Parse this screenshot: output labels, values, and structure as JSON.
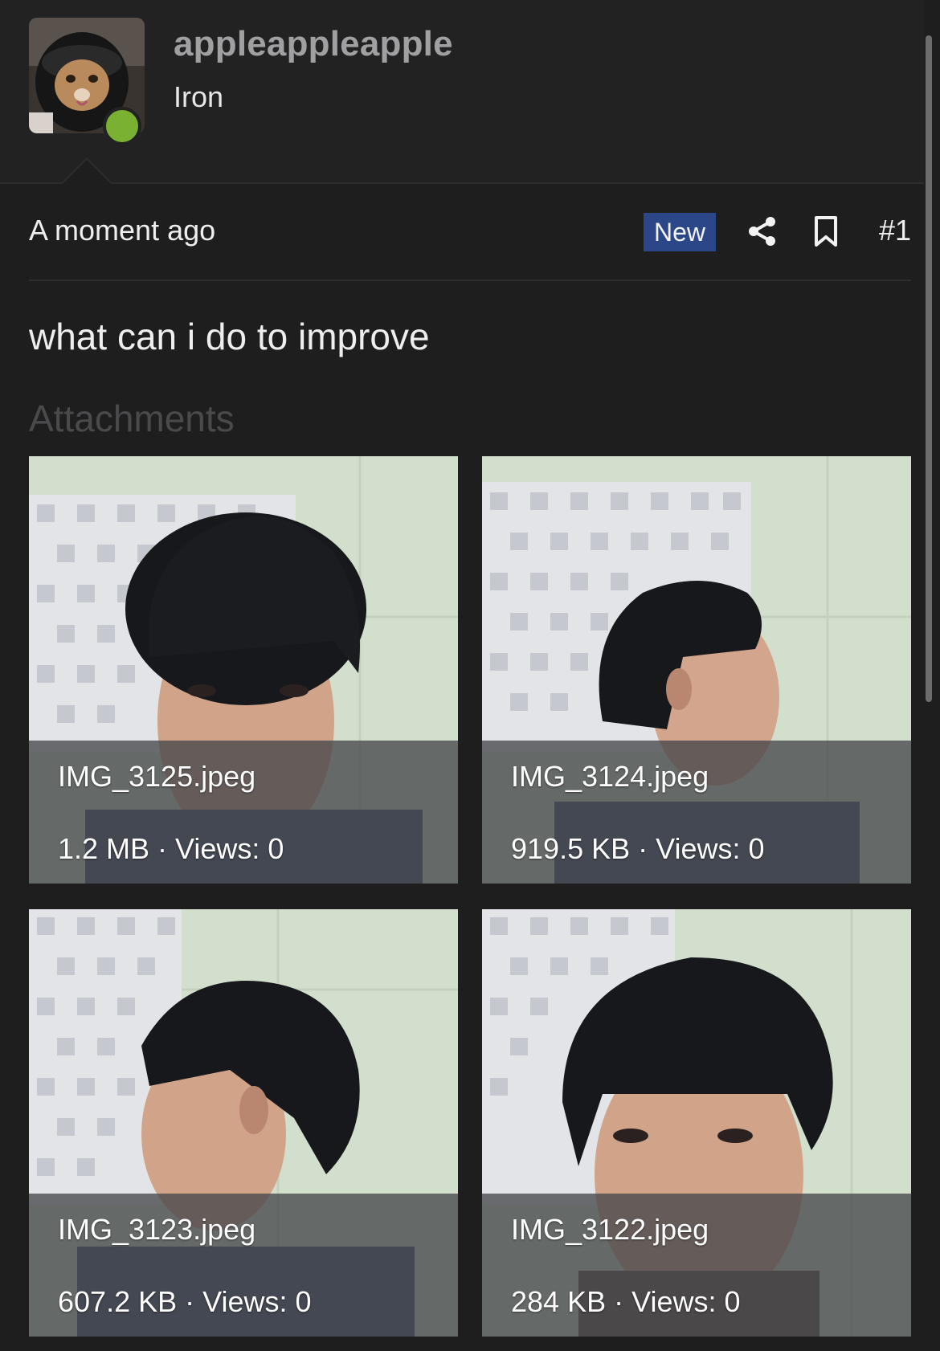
{
  "user": {
    "name": "appleappleapple",
    "title": "Iron",
    "status_color": "#7bb132"
  },
  "post": {
    "time": "A moment ago",
    "badge": "New",
    "number": "#1",
    "body": "what can i do to improve"
  },
  "icons": {
    "share": "share-icon",
    "bookmark": "bookmark-icon"
  },
  "attachments": {
    "heading": "Attachments",
    "items": [
      {
        "name": "IMG_3125.jpeg",
        "meta": "1.2 MB · Views: 0"
      },
      {
        "name": "IMG_3124.jpeg",
        "meta": "919.5 KB · Views: 0"
      },
      {
        "name": "IMG_3123.jpeg",
        "meta": "607.2 KB · Views: 0"
      },
      {
        "name": "IMG_3122.jpeg",
        "meta": "284 KB · Views: 0"
      }
    ]
  },
  "colors": {
    "background": "#1e1e1f",
    "badge": "#2c4787",
    "muted": "#a0a0a2"
  }
}
